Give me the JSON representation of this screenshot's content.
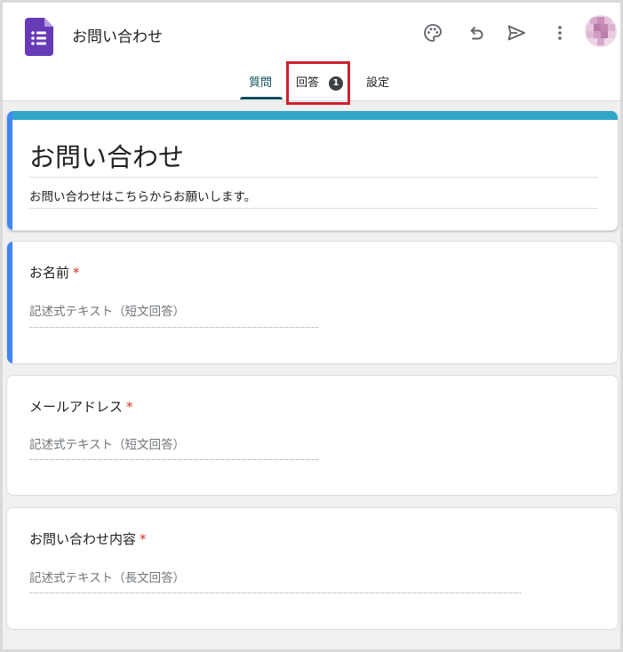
{
  "header": {
    "title": "お問い合わせ",
    "icons": [
      "forms-logo-icon",
      "palette-icon",
      "undo-icon",
      "send-icon",
      "more-vert-icon",
      "avatar"
    ]
  },
  "tabs": [
    {
      "label": "質問",
      "active": true
    },
    {
      "label": "回答",
      "badge": "1"
    },
    {
      "label": "設定"
    }
  ],
  "form": {
    "title": "お問い合わせ",
    "description": "お問い合わせはこちらからお願いします。"
  },
  "questions": [
    {
      "title": "お名前",
      "required_mark": "*",
      "placeholder": "記述式テキスト（短文回答）"
    },
    {
      "title": "メールアドレス",
      "required_mark": "*",
      "placeholder": "記述式テキスト（短文回答）"
    },
    {
      "title": "お問い合わせ内容",
      "required_mark": "*",
      "placeholder": "記述式テキスト（長文回答）"
    }
  ],
  "colors": {
    "theme": "#30a7c7",
    "active_tab": "#0b4f5c",
    "focus_accent": "#4285f4",
    "required": "#d93025",
    "annotation_box": "#d0202e",
    "forms_logo": "#673ab7"
  }
}
